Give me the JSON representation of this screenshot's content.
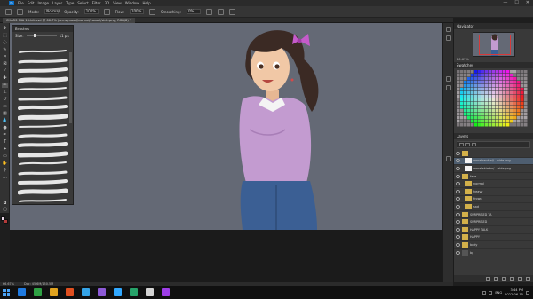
{
  "app": {
    "menu": [
      "File",
      "Edit",
      "Image",
      "Layer",
      "Type",
      "Select",
      "Filter",
      "3D",
      "View",
      "Window",
      "Help"
    ],
    "window_controls": [
      "—",
      "☐",
      "✕"
    ]
  },
  "options_bar": {
    "mode_label": "Mode:",
    "mode_value": "Normal",
    "opacity_label": "Opacity:",
    "opacity_value": "100%",
    "flow_label": "Flow:",
    "flow_value": "100%",
    "smoothing_label": "Smoothing:",
    "smoothing_value": "0%"
  },
  "document": {
    "tab_title": "CHARS MIA 16-bit.psd @ 66.7% (arms/mood/normal/casual/side.png, RGB/8) *"
  },
  "brushes_panel": {
    "title": "Brushes",
    "size_label": "Size:",
    "size_value": "11 px",
    "brush_count": 17
  },
  "navigator": {
    "title": "Navigator",
    "zoom": "66.67%"
  },
  "swatches": {
    "title": "Swatches"
  },
  "layers": {
    "title": "Layers",
    "search_placeholder": "Kind",
    "rows": [
      {
        "name": "",
        "thumb": "folder",
        "indent": 0,
        "selected": false
      },
      {
        "name": "arms/neutral/... side.png",
        "thumb": "white",
        "indent": 1,
        "selected": true
      },
      {
        "name": "arms/akimbo/... side.png",
        "thumb": "white",
        "indent": 1,
        "selected": false
      },
      {
        "name": "face",
        "thumb": "folder",
        "indent": 0,
        "selected": false
      },
      {
        "name": "normal",
        "thumb": "folder",
        "indent": 1,
        "selected": false
      },
      {
        "name": "heavy",
        "thumb": "folder",
        "indent": 1,
        "selected": false
      },
      {
        "name": "frown",
        "thumb": "folder",
        "indent": 1,
        "selected": false
      },
      {
        "name": "sad",
        "thumb": "folder",
        "indent": 1,
        "selected": false
      },
      {
        "name": "SURPRISED TA",
        "thumb": "folder",
        "indent": 0,
        "selected": false
      },
      {
        "name": "SURPRISED",
        "thumb": "folder",
        "indent": 0,
        "selected": false
      },
      {
        "name": "HAPPY TALK",
        "thumb": "folder",
        "indent": 0,
        "selected": false
      },
      {
        "name": "HAPPY",
        "thumb": "folder",
        "indent": 0,
        "selected": false
      },
      {
        "name": "body",
        "thumb": "folder",
        "indent": 0,
        "selected": false
      },
      {
        "name": "bg",
        "thumb": "dark",
        "indent": 0,
        "selected": false
      }
    ]
  },
  "status_bar": {
    "zoom": "66.67%",
    "doc": "Doc: 45.6M/150.5M"
  },
  "taskbar": {
    "time": "3:44 PM",
    "date": "2022-06-15",
    "lang": "ENG",
    "app_colors": [
      "#1f7ae0",
      "#2ea043",
      "#e0a31f",
      "#e04f1f",
      "#35a3e6",
      "#8c5ad6",
      "#31a8ff",
      "#26a269",
      "#d3d3d3",
      "#9d3ee6"
    ]
  },
  "colors": {
    "canvas_bg": "#646975",
    "shirt": "#c39bd0",
    "hair": "#3b2a24",
    "jeans": "#3b5f94",
    "bow": "#c55bcb",
    "skin": "#f1c8a6",
    "accent": "#31a8ff"
  }
}
